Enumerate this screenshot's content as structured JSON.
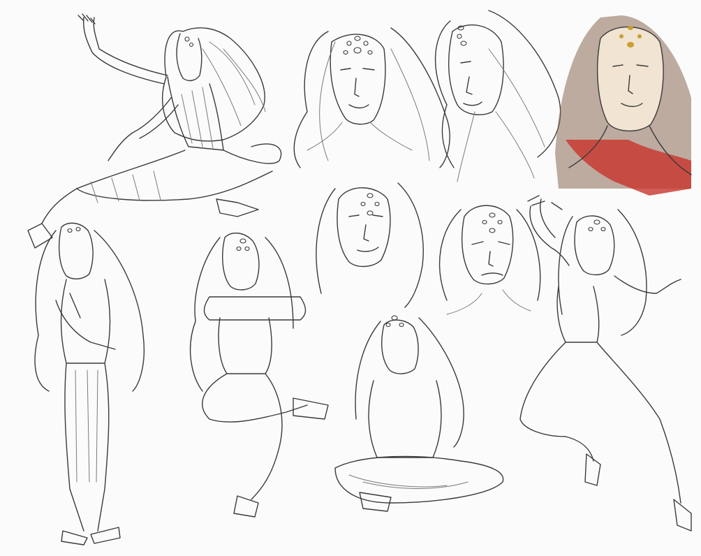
{
  "image": {
    "kind": "pencil character sketch sheet",
    "colors": {
      "paper": "#fbfbfb",
      "pencil": "#3a3a3a",
      "hair_colored": "#8a6a55",
      "robe_colored": "#c8342c",
      "skin_colored": "#f1e4d2",
      "gem_colored": "#c8a032"
    }
  }
}
